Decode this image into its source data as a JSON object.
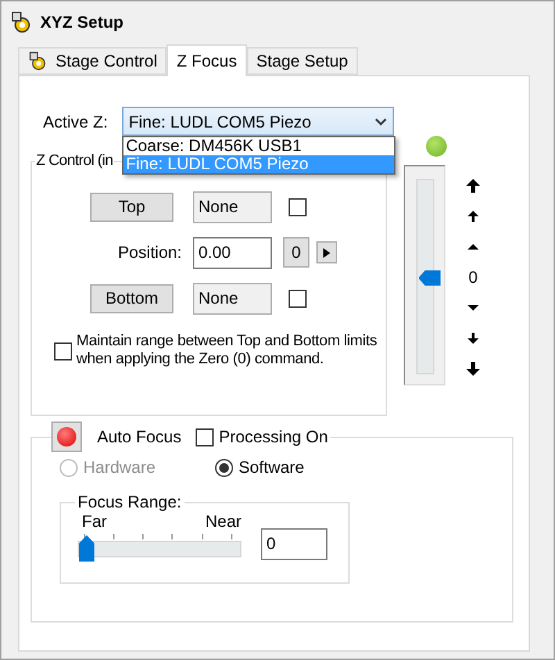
{
  "window": {
    "title": "XYZ Setup"
  },
  "tabs": [
    {
      "label": "Stage Control",
      "selected": false,
      "icon": true
    },
    {
      "label": "Z Focus",
      "selected": true,
      "icon": false
    },
    {
      "label": "Stage Setup",
      "selected": false,
      "icon": false
    }
  ],
  "active_z": {
    "label": "Active Z:",
    "value": "Fine: LUDL COM5 Piezo",
    "expanded": true,
    "options": [
      {
        "label": "Coarse: DM456K USB1",
        "selected": false
      },
      {
        "label": "Fine: LUDL COM5 Piezo",
        "selected": true
      }
    ]
  },
  "z_control": {
    "title": "Z Control (in",
    "top": {
      "button": "Top",
      "value": "None",
      "checked": false
    },
    "position": {
      "label": "Position:",
      "value": "0.00",
      "step": "0"
    },
    "bottom": {
      "button": "Bottom",
      "value": "None",
      "checked": false
    },
    "maintain": {
      "label": "Maintain range between Top and Bottom limits when applying the Zero (0) command.",
      "checked": false
    }
  },
  "z_slider": {
    "level": 0.5,
    "reading": "0"
  },
  "auto_focus": {
    "title": "Auto Focus",
    "processing": {
      "label": "Processing On",
      "checked": false
    },
    "modes": [
      {
        "label": "Hardware",
        "selected": false,
        "disabled": true
      },
      {
        "label": "Software",
        "selected": true,
        "disabled": false
      }
    ],
    "focus_range": {
      "title": "Focus Range:",
      "min_label": "Far",
      "max_label": "Near",
      "level": 0,
      "value": "0"
    }
  }
}
